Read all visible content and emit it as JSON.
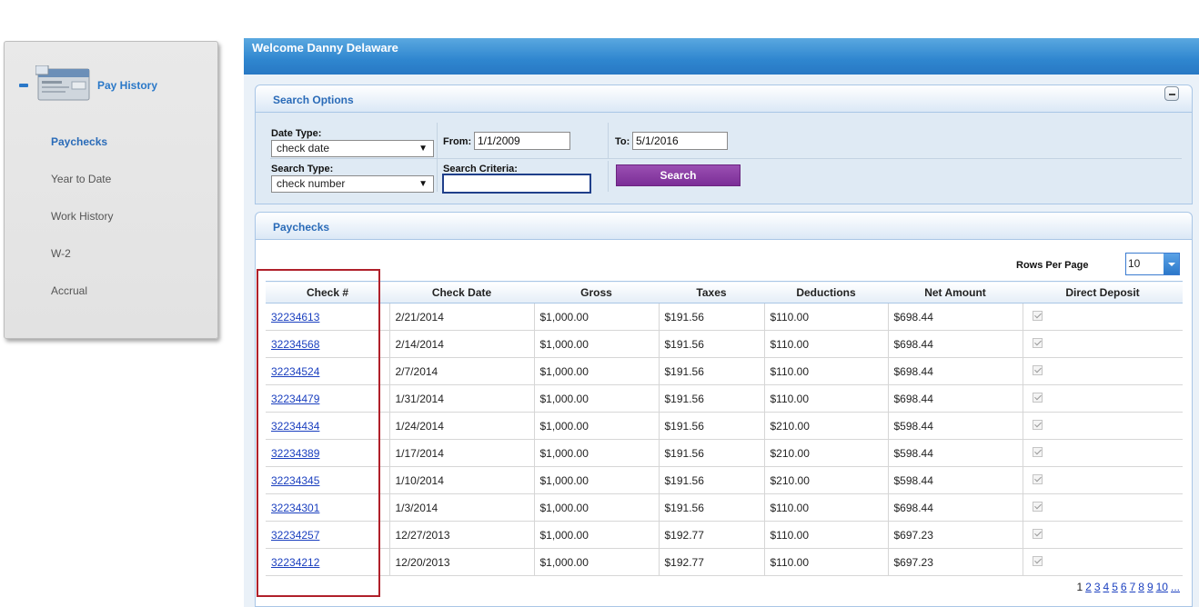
{
  "sidebar": {
    "title": "Pay History",
    "items": [
      {
        "label": "Paychecks",
        "active": true
      },
      {
        "label": "Year to Date",
        "active": false
      },
      {
        "label": "Work History",
        "active": false
      },
      {
        "label": "W-2",
        "active": false
      },
      {
        "label": "Accrual",
        "active": false
      }
    ]
  },
  "header": {
    "welcome": "Welcome Danny Delaware"
  },
  "search_options": {
    "title": "Search Options",
    "date_type_label": "Date Type:",
    "date_type_value": "check date",
    "from_label": "From:",
    "from_value": "1/1/2009",
    "to_label": "To:",
    "to_value": "5/1/2016",
    "search_type_label": "Search Type:",
    "search_type_value": "check number",
    "criteria_label": "Search Criteria:",
    "criteria_value": "",
    "search_button": "Search"
  },
  "paychecks": {
    "title": "Paychecks",
    "rows_per_page_label": "Rows Per Page",
    "rows_per_page_value": "10",
    "columns": [
      "Check #",
      "Check Date",
      "Gross",
      "Taxes",
      "Deductions",
      "Net Amount",
      "Direct Deposit"
    ],
    "rows": [
      [
        "32234613",
        "2/21/2014",
        "$1,000.00",
        "$191.56",
        "$110.00",
        "$698.44"
      ],
      [
        "32234568",
        "2/14/2014",
        "$1,000.00",
        "$191.56",
        "$110.00",
        "$698.44"
      ],
      [
        "32234524",
        "2/7/2014",
        "$1,000.00",
        "$191.56",
        "$110.00",
        "$698.44"
      ],
      [
        "32234479",
        "1/31/2014",
        "$1,000.00",
        "$191.56",
        "$110.00",
        "$698.44"
      ],
      [
        "32234434",
        "1/24/2014",
        "$1,000.00",
        "$191.56",
        "$210.00",
        "$598.44"
      ],
      [
        "32234389",
        "1/17/2014",
        "$1,000.00",
        "$191.56",
        "$210.00",
        "$598.44"
      ],
      [
        "32234345",
        "1/10/2014",
        "$1,000.00",
        "$191.56",
        "$210.00",
        "$598.44"
      ],
      [
        "32234301",
        "1/3/2014",
        "$1,000.00",
        "$191.56",
        "$110.00",
        "$698.44"
      ],
      [
        "32234257",
        "12/27/2013",
        "$1,000.00",
        "$192.77",
        "$110.00",
        "$697.23"
      ],
      [
        "32234212",
        "12/20/2013",
        "$1,000.00",
        "$192.77",
        "$110.00",
        "$697.23"
      ]
    ],
    "pages": [
      "1",
      "2",
      "3",
      "4",
      "5",
      "6",
      "7",
      "8",
      "9",
      "10",
      "..."
    ],
    "current_page": "1"
  }
}
